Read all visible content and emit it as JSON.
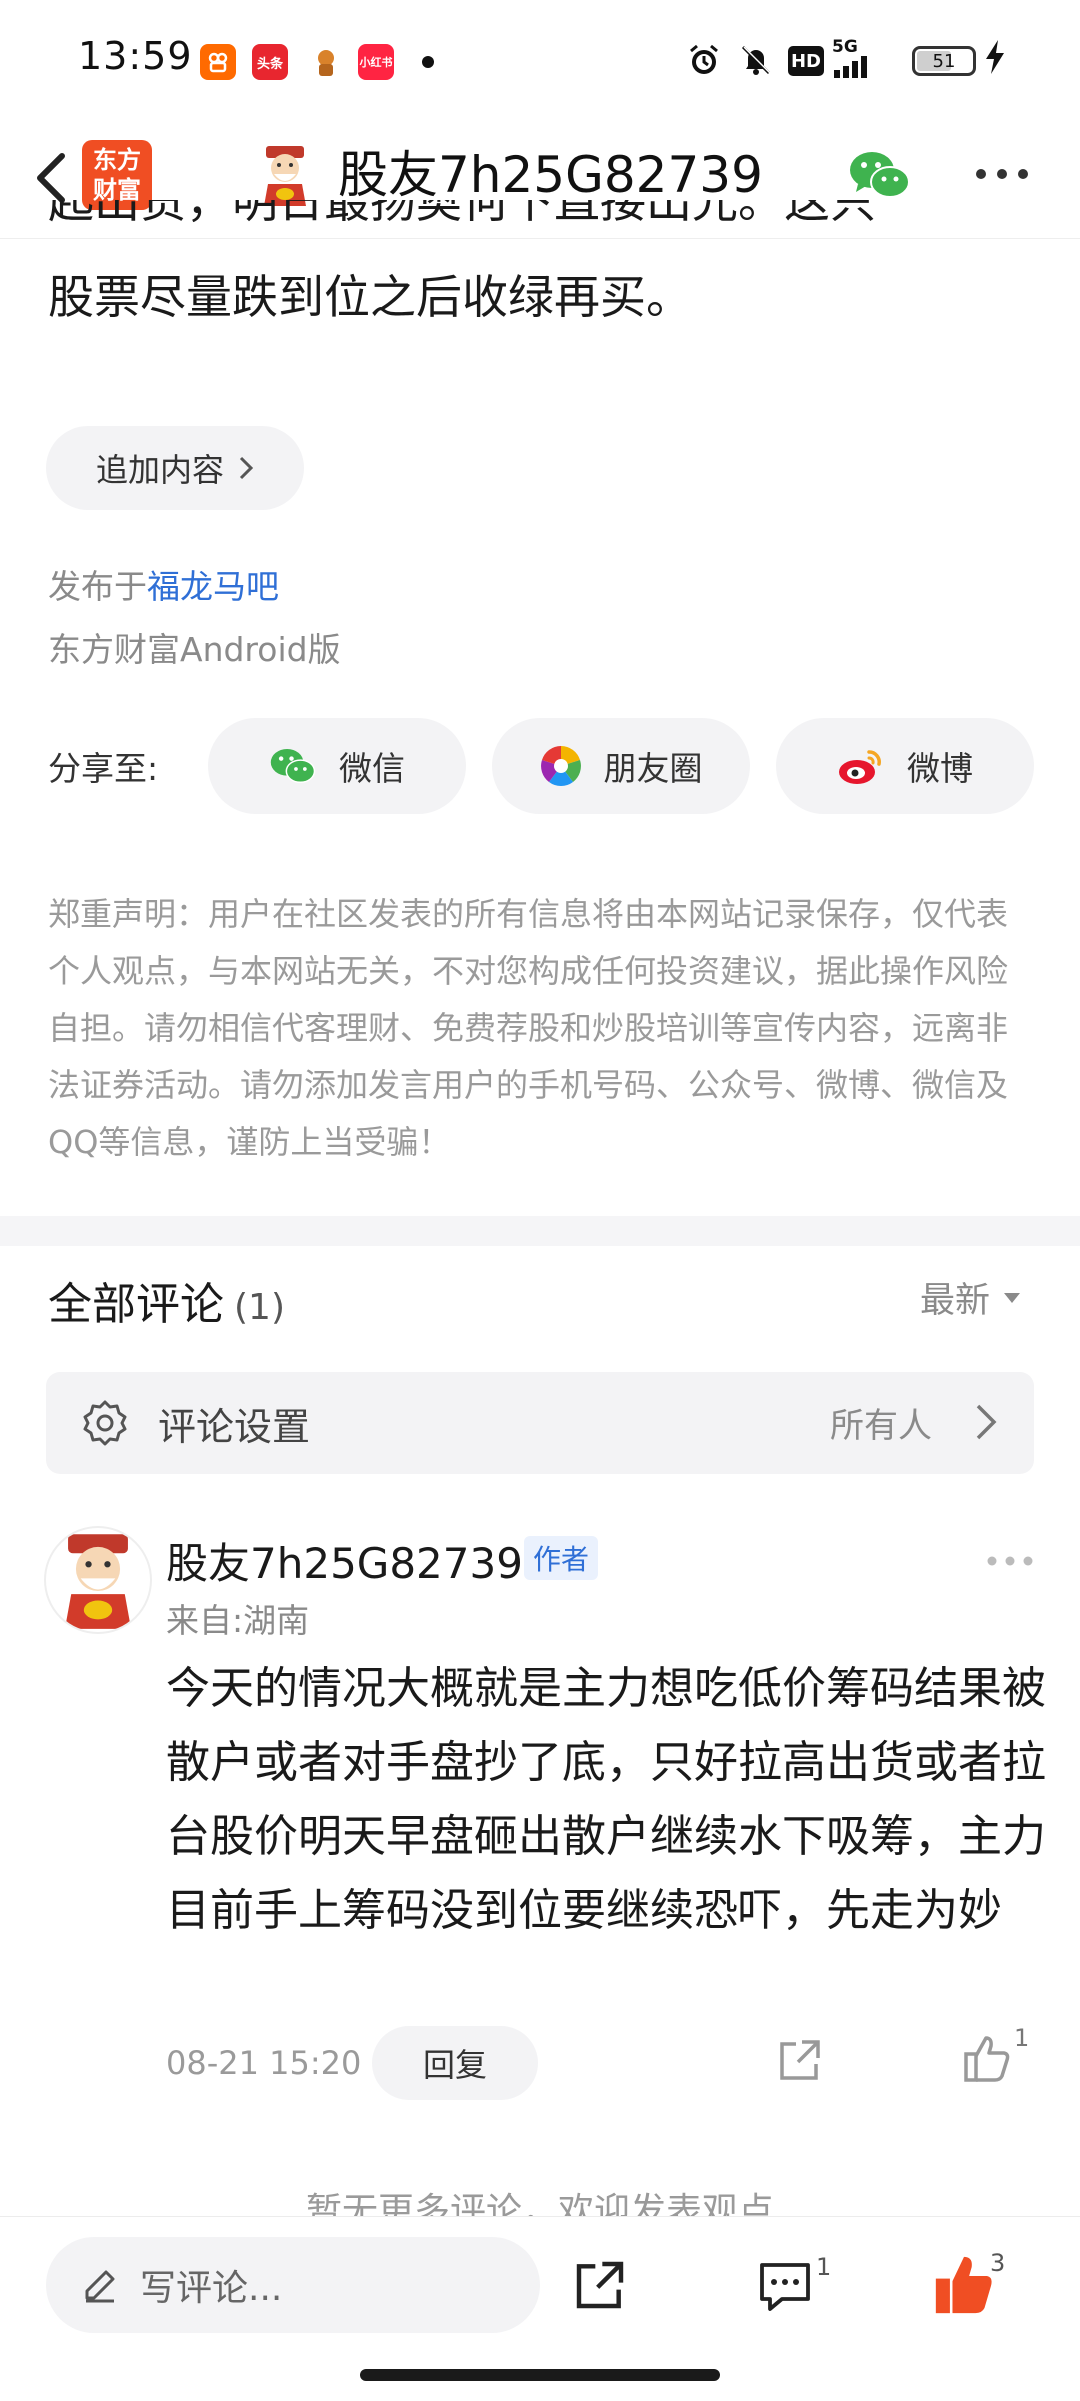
{
  "status_bar": {
    "time": "13:59",
    "apps": [
      "kuaishou-app-icon",
      "toutiao-app-icon",
      "game-app-icon",
      "xiaohongshu-app-icon"
    ],
    "app_labels": [
      "",
      "头条",
      "",
      "小红书"
    ],
    "network": "HD",
    "signal": "5G",
    "battery": "51"
  },
  "nav": {
    "logo_text": "东方财富",
    "title": "股友7h25G82739"
  },
  "article": {
    "partial_line": "起出货，明日最扬奥何下直接出光。这只",
    "last_line": "股票尽量跌到位之后收绿再买。",
    "append_button": "追加内容",
    "published_prefix": "发布于",
    "published_forum": "福龙马吧",
    "client": "东方财富Android版"
  },
  "share": {
    "label": "分享至:",
    "options": [
      {
        "name": "wechat",
        "label": "微信",
        "color": "#3fb34f"
      },
      {
        "name": "moments",
        "label": "朋友圈",
        "color": "#e8a33c"
      },
      {
        "name": "weibo",
        "label": "微博",
        "color": "#e6162d"
      }
    ]
  },
  "disclaimer": "郑重声明：用户在社区发表的所有信息将由本网站记录保存，仅代表个人观点，与本网站无关，不对您构成任何投资建议，据此操作风险自担。请勿相信代客理财、免费荐股和炒股培训等宣传内容，远离非法证券活动。请勿添加发言用户的手机号码、公众号、微博、微信及QQ等信息，谨防上当受骗！",
  "comments": {
    "title": "全部评论",
    "count": "(1)",
    "sort": "最新",
    "settings_label": "评论设置",
    "settings_value": "所有人",
    "items": [
      {
        "author": "股友7h25G82739",
        "badge": "作者",
        "location": "来自:湖南",
        "text": "今天的情况大概就是主力想吃低价筹码结果被散户或者对手盘抄了底，只好拉高出货或者拉台股价明天早盘砸出散户继续水下吸筹，主力目前手上筹码没到位要继续恐吓，先走为妙",
        "time": "08-21 15:20",
        "reply_label": "回复",
        "likes": "1"
      }
    ],
    "no_more": "暂无更多评论，欢迎发表观点"
  },
  "bottom_bar": {
    "input_placeholder": "写评论...",
    "comment_count": "1",
    "like_count": "3",
    "like_color": "#f04e23"
  }
}
